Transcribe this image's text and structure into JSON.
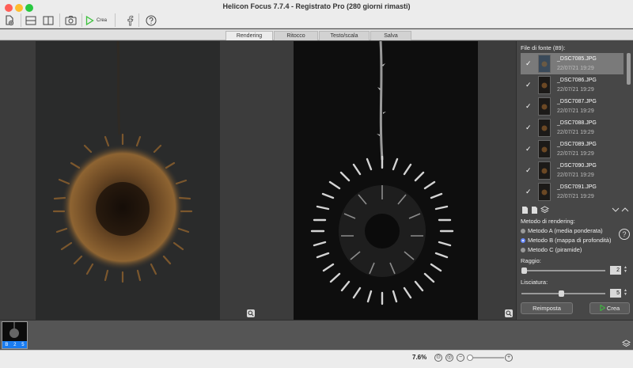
{
  "window": {
    "title": "Helicon Focus 7.7.4 - Registrato Pro  (280 giorni rimasti)"
  },
  "toolbar": {
    "create_label": "Crea"
  },
  "tabs": [
    {
      "label": "Rendering"
    },
    {
      "label": "Ritocco"
    },
    {
      "label": "Testo/scala"
    },
    {
      "label": "Salva"
    }
  ],
  "files": {
    "header": "File di fonte (89):",
    "items": [
      {
        "name": "_DSC7085.JPG",
        "date": "22/07/21 19:29"
      },
      {
        "name": "_DSC7086.JPG",
        "date": "22/07/21 19:29"
      },
      {
        "name": "_DSC7087.JPG",
        "date": "22/07/21 19:29"
      },
      {
        "name": "_DSC7088.JPG",
        "date": "22/07/21 19:29"
      },
      {
        "name": "_DSC7089.JPG",
        "date": "22/07/21 19:29"
      },
      {
        "name": "_DSC7090.JPG",
        "date": "22/07/21 19:29"
      },
      {
        "name": "_DSC7091.JPG",
        "date": "22/07/21 19:29"
      }
    ]
  },
  "rendering": {
    "method_label": "Metodo di rendering:",
    "methods": [
      {
        "label": "Metodo A (media ponderata)"
      },
      {
        "label": "Metodo B (mappa di profondità)"
      },
      {
        "label": "Metodo C (piramide)"
      }
    ],
    "help": "?",
    "radius_label": "Raggio:",
    "radius_value": "2",
    "smoothing_label": "Lisciatura:",
    "smoothing_value": "5",
    "reset_label": "Reimposta",
    "create_label": "Crea"
  },
  "strip": {
    "badge_b": "B",
    "badge_2": "2",
    "badge_5": "5"
  },
  "status": {
    "zoom": "7.6%"
  },
  "colors": {
    "accent": "#1a7cf0",
    "create_green": "#3cc13c"
  }
}
